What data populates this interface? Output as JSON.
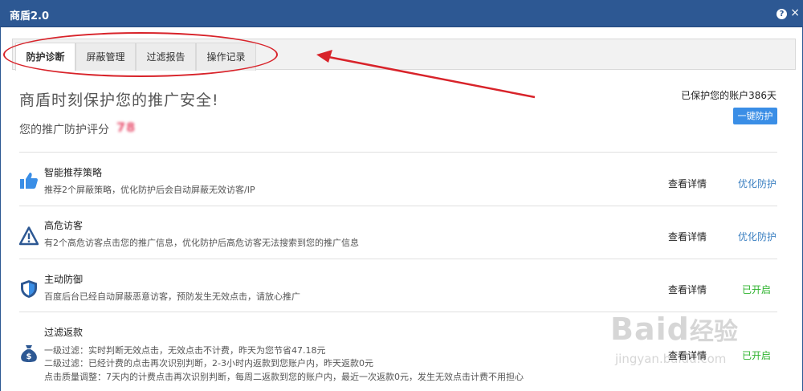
{
  "window": {
    "title": "商盾2.0",
    "help_icon": "?",
    "close_icon": "×"
  },
  "tabs": [
    {
      "label": "防护诊断",
      "active": true
    },
    {
      "label": "屏蔽管理",
      "active": false
    },
    {
      "label": "过滤报告",
      "active": false
    },
    {
      "label": "操作记录",
      "active": false
    }
  ],
  "summary": {
    "headline": "商盾时刻保护您的推广安全!",
    "score_label": "您的推广防护评分",
    "score_value": "78",
    "protected_days": "已保护您的账户386天",
    "one_click_button": "一键防护"
  },
  "items": [
    {
      "icon": "thumbs-up-icon",
      "title": "智能推荐策略",
      "desc": "推荐2个屏蔽策略，优化防护后会自动屏蔽无效访客/IP",
      "detail": "查看详情",
      "action": "优化防护"
    },
    {
      "icon": "warning-icon",
      "title": "高危访客",
      "desc": "有2个高危访客点击您的推广信息，优化防护后高危访客无法搜索到您的推广信息",
      "detail": "查看详情",
      "action": "优化防护"
    },
    {
      "icon": "shield-icon",
      "title": "主动防御",
      "desc": "百度后台已经自动屏蔽恶意访客，预防发生无效点击，请放心推广",
      "detail": "查看详情",
      "status": "已开启"
    },
    {
      "icon": "money-bag-icon",
      "title": "过滤返款",
      "desc_lines": [
        "一级过滤：实时判断无效点击，无效点击不计费，昨天为您节省47.18元",
        "二级过滤：已经计费的点击再次识别判断，2-3小时内返款到您账户内，昨天返款0元",
        "点击质量调整：7天内的计费点击再次识别判断，每周二返款到您的账户内，最近一次返款0元，发生无效点击计费不用担心"
      ],
      "detail": "查看详情",
      "status": "已开启"
    }
  ],
  "watermark": {
    "main": "Baid",
    "cn": "经验",
    "url": "jingyan.baidu.com"
  },
  "colors": {
    "titlebar": "#2d5893",
    "accent_blue": "#3a8ee6",
    "link_blue": "#3a7fc1",
    "enabled_green": "#2fb32f",
    "annotation_red": "#d8232a"
  }
}
